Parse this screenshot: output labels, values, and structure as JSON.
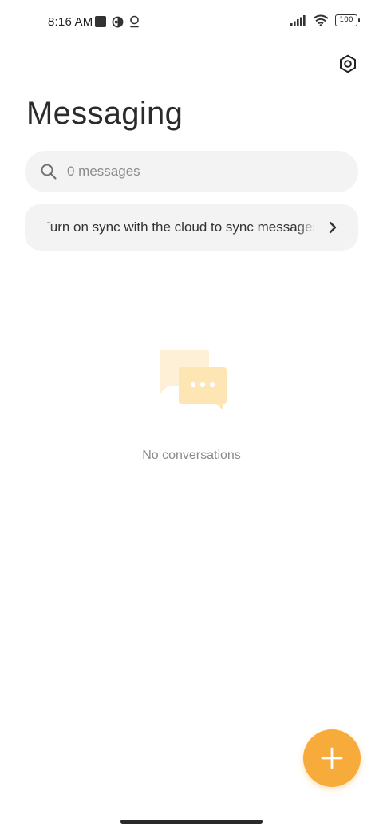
{
  "status_bar": {
    "time": "8:16 AM",
    "battery": "100"
  },
  "header": {
    "title": "Messaging"
  },
  "search": {
    "placeholder": "0 messages"
  },
  "sync_banner": {
    "text": "Turn on sync with the cloud to sync messages"
  },
  "empty_state": {
    "text": "No conversations"
  },
  "colors": {
    "accent": "#f6ab3a",
    "illustration_back": "#fdf0d6",
    "illustration_front": "#fde5b4",
    "surface": "#f3f3f3"
  },
  "icons": {
    "settings": "settings-hex-icon",
    "search": "search-icon",
    "chevron": "chevron-right-icon",
    "fab": "plus-icon"
  }
}
